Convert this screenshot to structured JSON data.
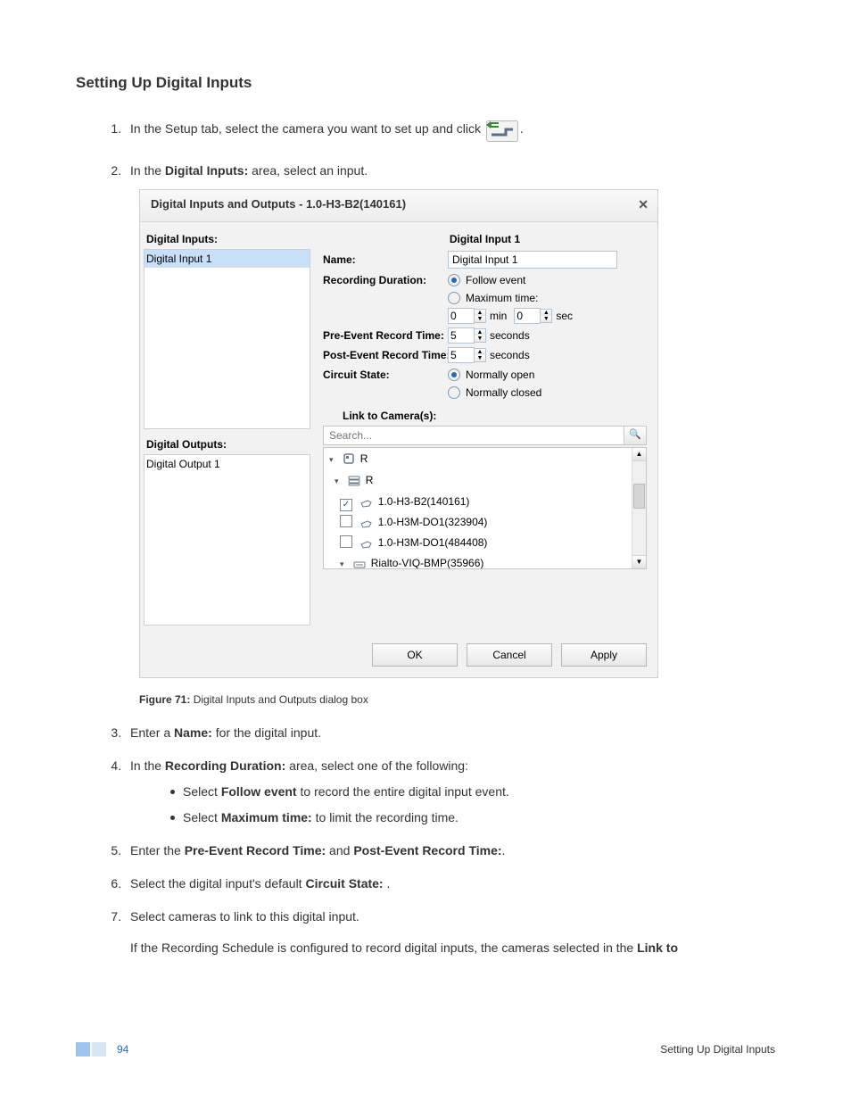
{
  "heading": "Setting Up Digital Inputs",
  "steps": {
    "s1_a": "In the Setup tab, select the camera you want to set up and click ",
    "s1_b": ".",
    "s2_a": "In the ",
    "s2_bold": "Digital Inputs:",
    "s2_b": " area, select an input."
  },
  "dialog": {
    "title": "Digital Inputs and Outputs - 1.0-H3-B2(140161)",
    "left": {
      "inputs_label": "Digital Inputs:",
      "input_item": "Digital Input 1",
      "outputs_label": "Digital Outputs:",
      "output_item": "Digital Output 1"
    },
    "right": {
      "header": "Digital Input 1",
      "name_label": "Name:",
      "name_value": "Digital Input 1",
      "recdur_label": "Recording Duration:",
      "follow_event": "Follow event",
      "max_time": "Maximum time:",
      "min_val": "0",
      "min_label": "min",
      "sec_val": "0",
      "sec_label": "sec",
      "pre_label": "Pre-Event Record Time:",
      "pre_val": "5",
      "post_label": "Post-Event Record Time:",
      "post_val": "5",
      "seconds": "seconds",
      "circuit_label": "Circuit State:",
      "normally_open": "Normally open",
      "normally_closed": "Normally closed",
      "link_label": "Link to Camera(s):",
      "search_placeholder": "Search...",
      "tree": {
        "root1": "R",
        "root2": "R",
        "cam1": "1.0-H3-B2(140161)",
        "cam2": "1.0-H3M-DO1(323904)",
        "cam3": "1.0-H3M-DO1(484408)",
        "enc1": "Rialto-VIQ-BMP(35966)"
      }
    },
    "buttons": {
      "ok": "OK",
      "cancel": "Cancel",
      "apply": "Apply"
    }
  },
  "figure": {
    "label": "Figure 71:",
    "text": " Digital Inputs and Outputs dialog box"
  },
  "steps2": {
    "s3_a": "Enter a ",
    "s3_bold": "Name:",
    "s3_b": " for the digital input.",
    "s4_a": "In the ",
    "s4_bold": "Recording Duration:",
    "s4_b": " area, select one of the following:",
    "b1_a": "Select ",
    "b1_bold": "Follow event",
    "b1_b": " to record the entire digital input event.",
    "b2_a": "Select ",
    "b2_bold": "Maximum time:",
    "b2_b": " to limit the recording time.",
    "s5_a": "Enter the ",
    "s5_bold1": "Pre-Event Record Time:",
    "s5_mid": " and ",
    "s5_bold2": "Post-Event Record Time:",
    "s5_b": ".",
    "s6_a": "Select the digital input's default ",
    "s6_bold": "Circuit State:",
    "s6_b": " .",
    "s7": "Select cameras to link to this digital input.",
    "s7p_a": "If the Recording Schedule is configured to record digital inputs, the cameras selected in the ",
    "s7p_bold": "Link to"
  },
  "footer": {
    "page": "94",
    "title": "Setting Up Digital Inputs"
  }
}
